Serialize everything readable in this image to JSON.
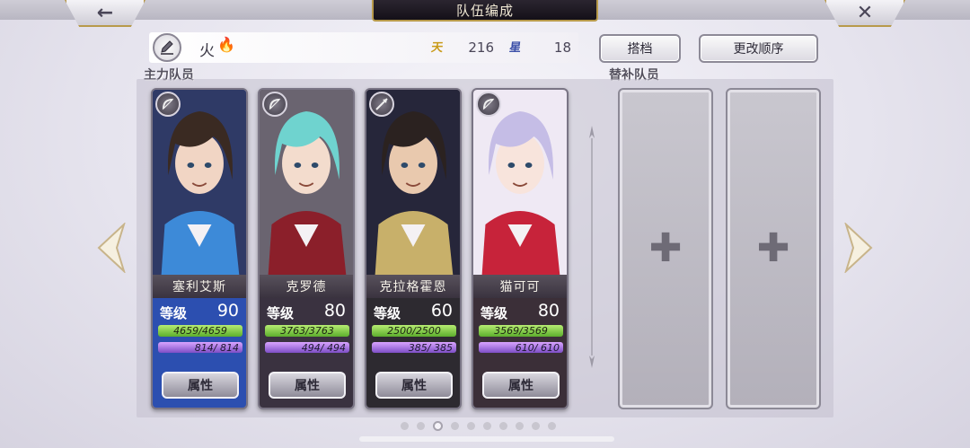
{
  "header": {
    "back_icon": "←",
    "title": "队伍编成",
    "close_icon": "✕"
  },
  "team": {
    "name": "火",
    "element_icon": "🔥",
    "stat1_icon": "天",
    "stat1_value": "216",
    "stat1_color": "#c99a18",
    "stat2_icon": "星",
    "stat2_value": "18",
    "stat2_color": "#3b4fa8"
  },
  "buttons": {
    "partner": "搭档",
    "reorder": "更改顺序"
  },
  "sections": {
    "main": "主力队员",
    "sub": "替补队员"
  },
  "members": [
    {
      "name": "塞利艾斯",
      "level_label": "等级",
      "level": "90",
      "hp": "4659/4659",
      "mp": "814/ 814",
      "attr_label": "属性",
      "class_icon": "bow-icon",
      "bg": "#2c4fb0",
      "art": "#2f3a66",
      "skin": "#f1d5c4",
      "hair": "#3a2a22",
      "accent": "#3d8ad8"
    },
    {
      "name": "克罗德",
      "level_label": "等级",
      "level": "80",
      "hp": "3763/3763",
      "mp": "494/ 494",
      "attr_label": "属性",
      "class_icon": "bow-icon",
      "bg": "#3a3240",
      "art": "#6a6470",
      "skin": "#f3dccd",
      "hair": "#6fd3cf",
      "accent": "#8b1f2a"
    },
    {
      "name": "克拉格霍恩",
      "level_label": "等级",
      "level": "60",
      "hp": "2500/2500",
      "mp": "385/ 385",
      "attr_label": "属性",
      "class_icon": "spear-icon",
      "bg": "#2d2a30",
      "art": "#26263a",
      "skin": "#e9c9ae",
      "hair": "#2b2220",
      "accent": "#c8b06a"
    },
    {
      "name": "猫可可",
      "level_label": "等级",
      "level": "80",
      "hp": "3569/3569",
      "mp": "610/ 610",
      "attr_label": "属性",
      "class_icon": "bow-icon",
      "bg": "#3b2f38",
      "art": "#efe9f4",
      "skin": "#f8e4dc",
      "hair": "#c5bde6",
      "accent": "#c7233a"
    }
  ],
  "page_indicator": {
    "count": 10,
    "active": 2
  }
}
